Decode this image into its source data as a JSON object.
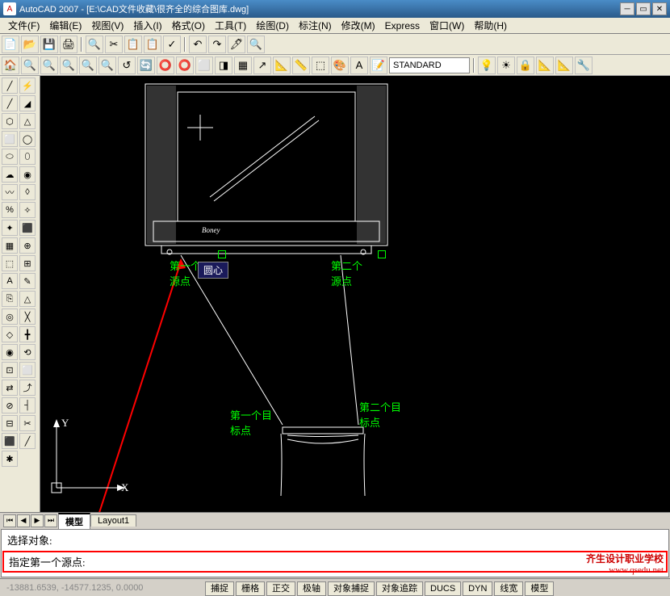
{
  "title": "AutoCAD 2007 - [E:\\CAD文件收藏\\很齐全的综合图库.dwg]",
  "menu": [
    "文件(F)",
    "编辑(E)",
    "视图(V)",
    "插入(I)",
    "格式(O)",
    "工具(T)",
    "绘图(D)",
    "标注(N)",
    "修改(M)",
    "Express",
    "窗口(W)",
    "帮助(H)"
  ],
  "toolbar1_icons": [
    "📄",
    "📂",
    "💾",
    "🖨",
    "🔍",
    "✂",
    "📋",
    "📋",
    "✓",
    "↶",
    "↷",
    "🖊",
    "🔍"
  ],
  "toolbar2_icons": [
    "🏠",
    "🔍",
    "🔍",
    "🔍",
    "🔍",
    "🔍",
    "↺",
    "🔄",
    "⭕",
    "⭕",
    "⬜",
    "◨",
    "▦",
    "↗",
    "📐",
    "📏",
    "⬚",
    "🎨",
    "A",
    "📝"
  ],
  "style_name": "STANDARD",
  "layer_icons": [
    "💡",
    "☀",
    "🔒",
    "📐",
    "📐",
    "🔧"
  ],
  "tabs": {
    "nav": [
      "⏮",
      "◀",
      "▶",
      "⏭"
    ],
    "items": [
      "模型",
      "Layout1"
    ],
    "active": 0
  },
  "cmd": {
    "line1": "选择对象:",
    "line2": "指定第一个源点:"
  },
  "status": {
    "coords": "-13881.6539, -14577.1235, 0.0000",
    "buttons": [
      "捕捉",
      "栅格",
      "正交",
      "极轴",
      "对象捕捉",
      "对象追踪",
      "DUCS",
      "DYN",
      "线宽",
      "模型"
    ]
  },
  "canvas": {
    "label1": "第一个\n源点",
    "label2": "第二个\n源点",
    "label3": "第一个目\n标点",
    "label4": "第二个目\n标点",
    "tooltip": "圆心",
    "axis_x": "X",
    "axis_y": "Y",
    "brand": "Boney"
  },
  "watermark": {
    "line1": "齐生设计职业学校",
    "line2": "www.qsedu.net"
  }
}
